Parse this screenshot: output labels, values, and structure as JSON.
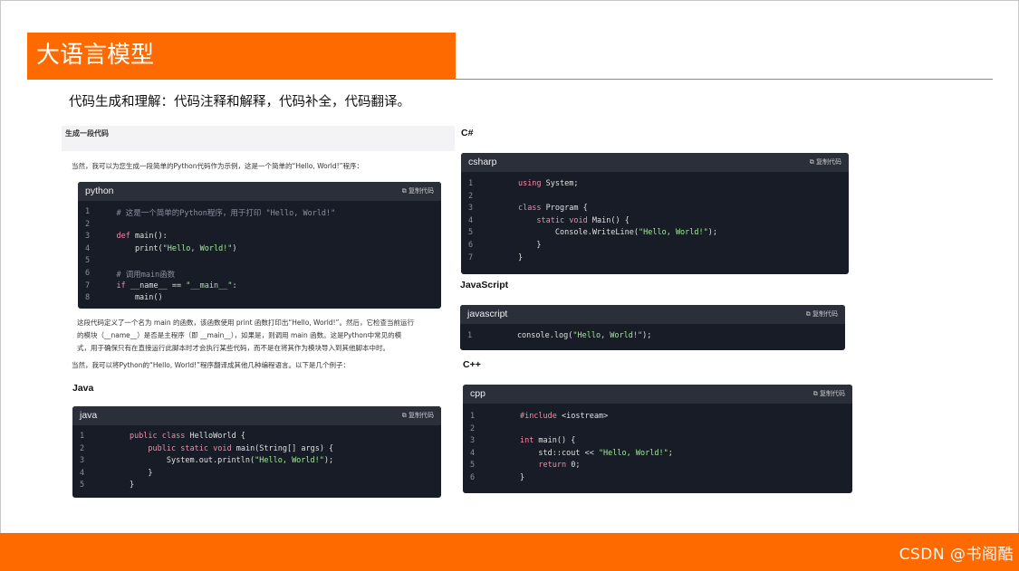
{
  "title": "大语言模型",
  "subtitle": "代码生成和理解：代码注释和解释，代码补全，代码翻译。",
  "footer": {
    "watermark": "CSDN @书阁酷"
  },
  "colors": {
    "accent": "#ff6a00",
    "code_bg": "#171c26",
    "code_header": "#2a2f3a"
  },
  "left_doc": {
    "heading": "生成一段代码",
    "intro": "当然，我可以为您生成一段简单的Python代码作为示例，这是一个简单的“Hello, World!”程序：",
    "explanation": [
      "这段代码定义了一个名为 main 的函数，该函数使用 print 函数打印出“Hello, World!”。然后，它检查当前运行",
      "的模块（__name__）是否是主程序（即 __main__），如果是，则调用 main 函数。这是Python中常见的模",
      "式，用于确保只有在直接运行此脚本时才会执行某些代码，而不是在将其作为模块导入到其他脚本中时。"
    ],
    "translate_intro": "当然，我可以将Python的“Hello, World!”程序翻译成其他几种编程语言。以下是几个例子："
  },
  "sections": {
    "java": "Java",
    "csharp": "C#",
    "javascript": "JavaScript",
    "cpp": "C++"
  },
  "code_blocks": {
    "python": {
      "lang": "python",
      "copy": "复制代码",
      "lines": [
        {
          "n": "1",
          "text": "    # 这是一个简单的Python程序，用于打印 \"Hello, World!\""
        },
        {
          "n": "2",
          "text": ""
        },
        {
          "n": "3",
          "text": "    def main():"
        },
        {
          "n": "4",
          "text": "        print(\"Hello, World!\")"
        },
        {
          "n": "5",
          "text": ""
        },
        {
          "n": "6",
          "text": "    # 调用main函数"
        },
        {
          "n": "7",
          "text": "    if __name__ == \"__main__\":"
        },
        {
          "n": "8",
          "text": "        main()"
        }
      ]
    },
    "java": {
      "lang": "java",
      "copy": "复制代码",
      "lines": [
        {
          "n": "1",
          "text": "        public class HelloWorld {"
        },
        {
          "n": "2",
          "text": "            public static void main(String[] args) {"
        },
        {
          "n": "3",
          "text": "                System.out.println(\"Hello, World!\");"
        },
        {
          "n": "4",
          "text": "            }"
        },
        {
          "n": "5",
          "text": "        }"
        }
      ]
    },
    "csharp": {
      "lang": "csharp",
      "copy": "复制代码",
      "lines": [
        {
          "n": "1",
          "text": "        using System;"
        },
        {
          "n": "2",
          "text": ""
        },
        {
          "n": "3",
          "text": "        class Program {"
        },
        {
          "n": "4",
          "text": "            static void Main() {"
        },
        {
          "n": "5",
          "text": "                Console.WriteLine(\"Hello, World!\");"
        },
        {
          "n": "6",
          "text": "            }"
        },
        {
          "n": "7",
          "text": "        }"
        }
      ]
    },
    "javascript": {
      "lang": "javascript",
      "copy": "复制代码",
      "lines": [
        {
          "n": "1",
          "text": "        console.log(\"Hello, World!\");"
        }
      ]
    },
    "cpp": {
      "lang": "cpp",
      "copy": "复制代码",
      "lines": [
        {
          "n": "1",
          "text": "        #include <iostream>"
        },
        {
          "n": "2",
          "text": ""
        },
        {
          "n": "3",
          "text": "        int main() {"
        },
        {
          "n": "4",
          "text": "            std::cout << \"Hello, World!\";"
        },
        {
          "n": "5",
          "text": "            return 0;"
        },
        {
          "n": "6",
          "text": "        }"
        }
      ]
    }
  }
}
